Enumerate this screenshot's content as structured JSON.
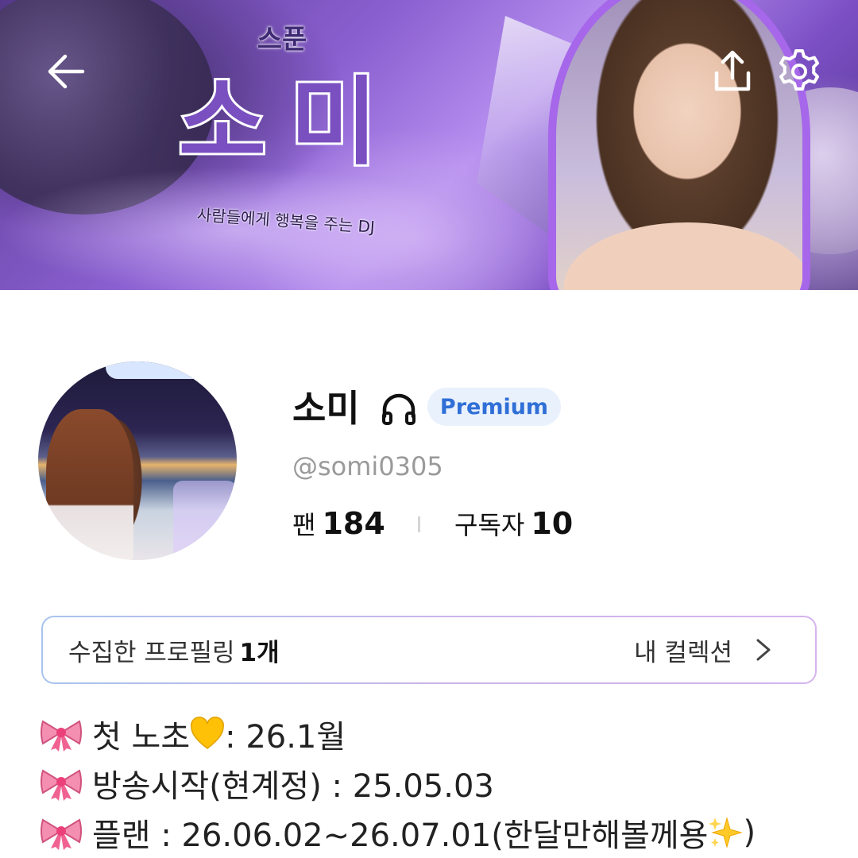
{
  "banner": {
    "sub_title": "스푼",
    "title": "소미",
    "tagline": "사람들에게 행복을 주는 DJ"
  },
  "nav": {
    "back_icon": "arrow-left-icon",
    "share_icon": "share-upload-icon",
    "settings_icon": "gear-icon"
  },
  "profile": {
    "name": "소미",
    "name_icon": "headphones-icon",
    "badge": "Premium",
    "handle": "@somi0305",
    "fans_label": "팬",
    "fans_count": "184",
    "subscribers_label": "구독자",
    "subscribers_count": "10"
  },
  "collection": {
    "label": "수집한 프로필링",
    "count": "1개",
    "link_label": "내 컬렉션",
    "link_icon": "chevron-right-icon"
  },
  "bio": {
    "line1_a": "첫 노초",
    "line1_b": " : 26.1월",
    "line2": "방송시작(현계정) : 25.05.03",
    "line3_a": "플랜 : 26.06.02~26.07.01(한달만해볼께용",
    "line3_b": ")",
    "bullet_icon": "ribbon-bow-icon"
  },
  "colors": {
    "accent_purple": "#a667ea",
    "premium_text": "#2f6fd6",
    "premium_bg": "#e9f1fd",
    "handle_gray": "#9a9a9a"
  }
}
